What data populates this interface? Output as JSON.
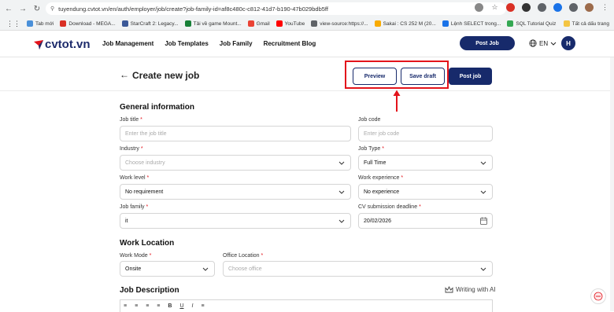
{
  "browser": {
    "url": "tuyendung.cvtot.vn/en/auth/employer/job/create?job-family-id=af8c480c-c812-41d7-b190-47b029bdb5ff",
    "bookmarks": [
      "Tab mới",
      "Download - MEGA...",
      "StarCraft 2: Legacy...",
      "Tải về game Mount...",
      "Gmail",
      "YouTube",
      "view-source:https://...",
      "Sakai : CS 252 M (20...",
      "Lệnh SELECT trong...",
      "SQL Tutorial Quiz"
    ],
    "all_bookmarks": "Tất cả dấu trang",
    "bookmark_colors": [
      "#4a90d9",
      "#d93025",
      "#3b5998",
      "#188038",
      "#ea4335",
      "#ff0000",
      "#5f6368",
      "#f9ab00",
      "#1a73e8",
      "#34a853"
    ]
  },
  "topnav": {
    "logo_text": "cvtot.vn",
    "links": [
      "Job Management",
      "Job Templates",
      "Job Family",
      "Recruitment Blog"
    ],
    "post_job": "Post Job",
    "lang": "EN",
    "avatar_initial": "H"
  },
  "header": {
    "title": "Create new job",
    "preview": "Preview",
    "save_draft": "Save draft",
    "post_job": "Post job"
  },
  "general": {
    "section_title": "General information",
    "job_title_label": "Job title",
    "job_title_placeholder": "Enter the job title",
    "job_code_label": "Job code",
    "job_code_placeholder": "Enter job code",
    "industry_label": "Industry",
    "industry_placeholder": "Choose industry",
    "job_type_label": "Job Type",
    "job_type_value": "Full Time",
    "work_level_label": "Work level",
    "work_level_value": "No requirement",
    "work_experience_label": "Work experience",
    "work_experience_value": "No experience",
    "job_family_label": "Job family",
    "job_family_value": "it",
    "cv_deadline_label": "CV submission deadline",
    "cv_deadline_value": "20/02/2026"
  },
  "location": {
    "section_title": "Work Location",
    "work_mode_label": "Work Mode",
    "work_mode_value": "Onsite",
    "office_label": "Office Location",
    "office_placeholder": "Choose office"
  },
  "description": {
    "section_title": "Job Description",
    "writing_ai": "Writing with AI",
    "toolbar": [
      "≡",
      "≡",
      "≡",
      "≡",
      "B",
      "U",
      "I",
      "≡"
    ]
  },
  "colors": {
    "brand": "#172a6b",
    "highlight": "#e3131b",
    "required": "#e3131b"
  }
}
